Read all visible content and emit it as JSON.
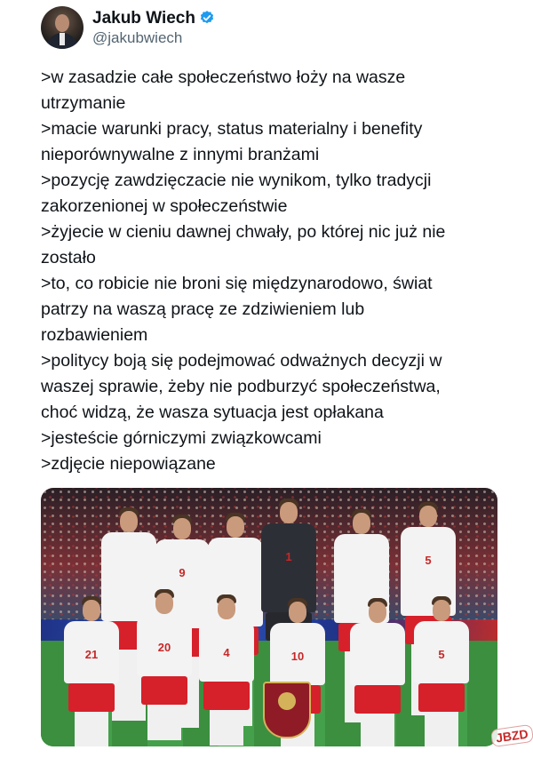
{
  "author": {
    "display_name": "Jakub Wiech",
    "handle": "@jakubwiech",
    "verified": true,
    "verified_color": "#1d9bf0"
  },
  "tweet": {
    "lines": [
      ">w zasadzie całe społeczeństwo łoży na wasze",
      "utrzymanie",
      ">macie warunki pracy, status materialny i benefity",
      "nieporównywalne z innymi branżami",
      ">pozycję zawdzięczacie nie wynikom, tylko tradycji",
      "zakorzenionej w społeczeństwie",
      ">żyjecie w cieniu dawnej chwały, po której nic już nie",
      "zostało",
      ">to, co robicie nie broni się międzynarodowo, świat",
      "patrzy na waszą pracę ze zdziwieniem lub",
      "rozbawieniem",
      ">politycy boją się podejmować odważnych decyzji w",
      "waszej sprawie, żeby nie podburzyć społeczeństwa,",
      "choć widzą, że wasza sytuacja jest opłakana",
      ">jesteście górniczymi związkowcami",
      ">zdjęcie niepowiązane"
    ]
  },
  "photo": {
    "back_row_numbers": [
      "",
      "9",
      "",
      "1",
      "",
      "5"
    ],
    "front_row_numbers": [
      "21",
      "20",
      "4",
      "10",
      "",
      "5"
    ]
  },
  "watermark": "JBZD"
}
